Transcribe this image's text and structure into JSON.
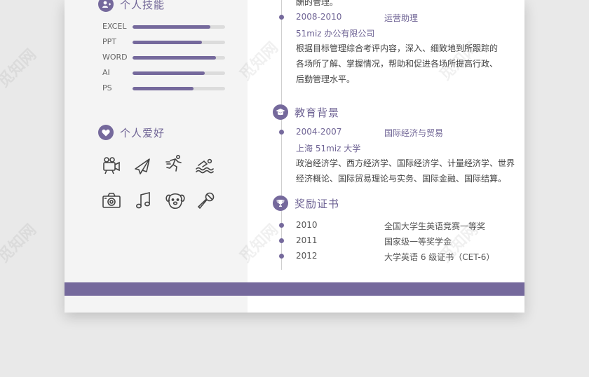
{
  "sections": {
    "skills_title": "个人技能",
    "hobbies_title": "个人爱好",
    "education_title": "教育背景",
    "awards_title": "奖励证书"
  },
  "skills": [
    {
      "name": "EXCEL",
      "level": 0.84
    },
    {
      "name": "PPT",
      "level": 0.75
    },
    {
      "name": "WORD",
      "level": 0.9
    },
    {
      "name": "AI",
      "level": 0.78
    },
    {
      "name": "PS",
      "level": 0.66
    }
  ],
  "hobbies": [
    "camera-icon",
    "airplane-icon",
    "running-icon",
    "swimming-icon",
    "photo-camera-icon",
    "music-note-icon",
    "dog-icon",
    "microphone-icon"
  ],
  "experience": {
    "intro_tail": "酬的管理。",
    "period": "2008-2010",
    "role": "运营助理",
    "company": "51miz 办公有限公司",
    "desc": [
      "根据目标管理综合考评内容，深入、细致地到所跟踪的",
      "各场所了解、掌握情况，帮助和促进各场所提高行政、",
      "后勤管理水平。"
    ]
  },
  "education": {
    "period": "2004-2007",
    "major": "国际经济与贸易",
    "school": "上海 51miz 大学",
    "desc": [
      "政治经济学、西方经济学、国际经济学、计量经济学、世界",
      "经济概论、国际贸易理论与实务、国际金融、国际结算。"
    ]
  },
  "awards": [
    {
      "year": "2010",
      "name": "全国大学生英语竞赛一等奖"
    },
    {
      "year": "2011",
      "name": "国家级一等奖学金"
    },
    {
      "year": "2012",
      "name": "大学英语 6 级证书（CET-6）"
    }
  ],
  "watermark": "觅知网",
  "colors": {
    "accent": "#75699c",
    "left_panel": "#f4f4f4",
    "background": "#e9e9e9"
  }
}
